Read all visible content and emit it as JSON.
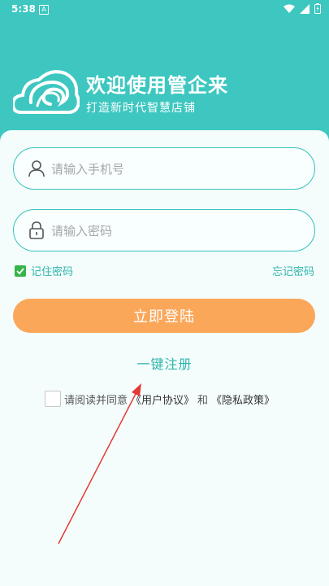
{
  "status_bar": {
    "time": "5:38",
    "notification_icon": "A"
  },
  "header": {
    "title": "欢迎使用管企来",
    "subtitle": "打造新时代智慧店铺"
  },
  "form": {
    "phone_placeholder": "请输入手机号",
    "password_placeholder": "请输入密码",
    "remember_label": "记住密码",
    "forgot_label": "忘记密码",
    "login_label": "立即登陆",
    "register_label": "一键注册"
  },
  "agreement": {
    "prefix": "请阅读并同意",
    "user_agreement": "《用户协议》",
    "and": "和",
    "privacy_policy": "《隐私政策》"
  },
  "colors": {
    "brand": "#3dc7c0",
    "button": "#fba75a",
    "arrow": "#e53935"
  }
}
